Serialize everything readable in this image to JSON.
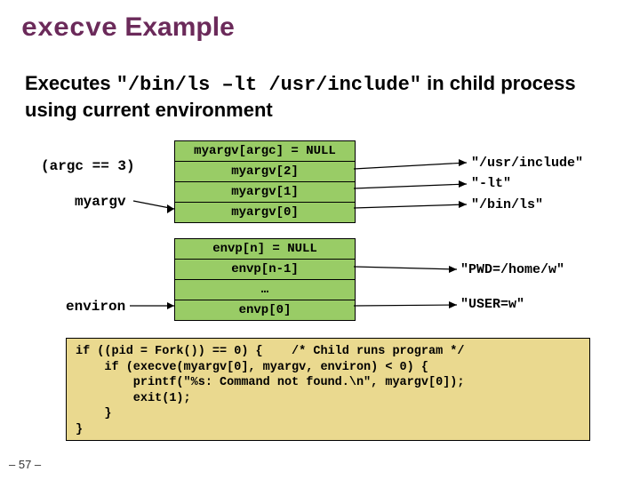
{
  "title": {
    "mono": "execve",
    "rest": " Example"
  },
  "subtitle": {
    "pre": "Executes ",
    "cmd": "\"/bin/ls –lt /usr/include\"",
    "post": " in child process using current environment"
  },
  "argv": {
    "rows": [
      "myargv[argc] = NULL",
      "myargv[2]",
      "myargv[1]",
      "myargv[0]"
    ],
    "side_label_argc": "(argc == 3)",
    "side_label_myargv": "myargv",
    "pointer_labels": [
      "\"/usr/include\"",
      "\"-lt\"",
      "\"/bin/ls\""
    ]
  },
  "envp": {
    "rows": [
      "envp[n] = NULL",
      "envp[n-1]",
      "…",
      "envp[0]"
    ],
    "side_label_environ": "environ",
    "pointer_labels": [
      "\"PWD=/home/w\"",
      "\"USER=w\""
    ]
  },
  "code": "if ((pid = Fork()) == 0) {    /* Child runs program */\n    if (execve(myargv[0], myargv, environ) < 0) {\n        printf(\"%s: Command not found.\\n\", myargv[0]);\n        exit(1);\n    }\n}",
  "pagenum": "– 57 –"
}
